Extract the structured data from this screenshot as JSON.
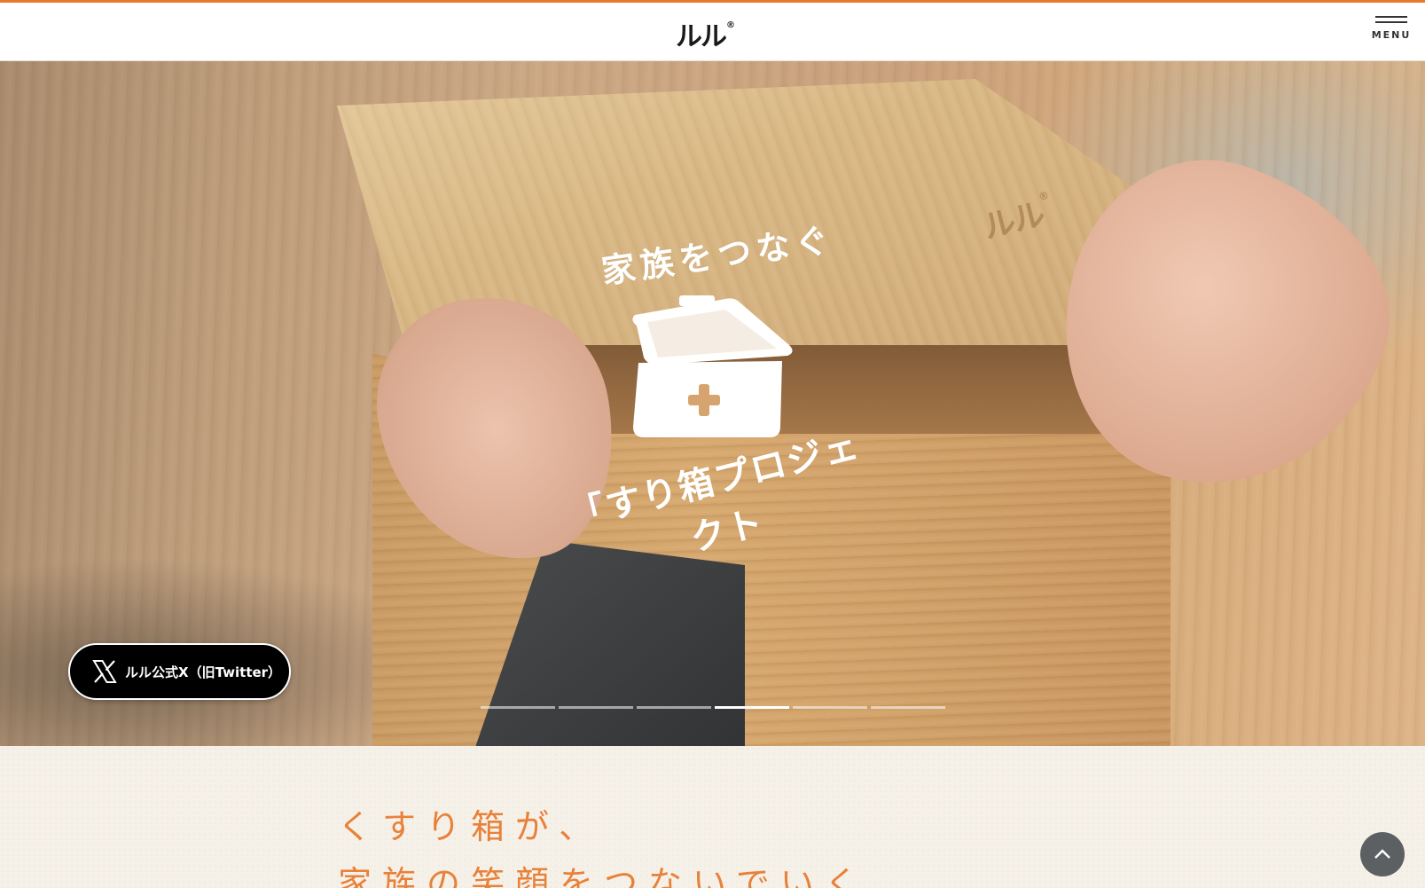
{
  "header": {
    "logo_text": "ルル",
    "logo_mark": "®",
    "menu_label": "MENU"
  },
  "hero": {
    "engraved_logo": "ルル",
    "engraved_mark": "®",
    "title_top": "家族をつなぐ",
    "title_bottom": "「すり箱プロジェクト",
    "icon": "first-aid-box-icon",
    "x_button_label": "ルル公式X（旧Twitter）",
    "slides": {
      "count": 6,
      "active_index": 3
    }
  },
  "intro": {
    "line1": "くすり箱が、",
    "line2": "家族の笑顔をつないでいく"
  },
  "colors": {
    "accent": "#e87a2e",
    "tagline": "#e8813a",
    "x_button_bg": "#000000",
    "back_to_top_bg": "#5d6062"
  }
}
